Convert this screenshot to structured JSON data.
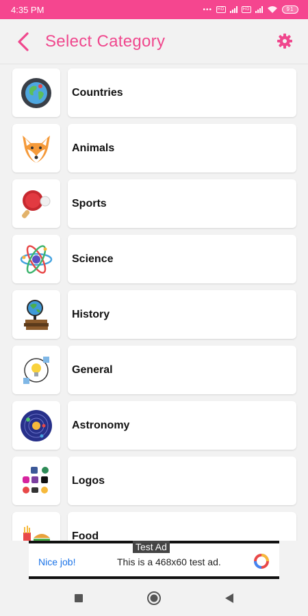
{
  "status_bar": {
    "time": "4:35 PM",
    "indicators": "•••",
    "battery": "91"
  },
  "header": {
    "title": "Select Category"
  },
  "categories": [
    {
      "label": "Countries",
      "icon": "globe-icon"
    },
    {
      "label": "Animals",
      "icon": "fox-icon"
    },
    {
      "label": "Sports",
      "icon": "ping-pong-icon"
    },
    {
      "label": "Science",
      "icon": "atom-icon"
    },
    {
      "label": "History",
      "icon": "globe-books-icon"
    },
    {
      "label": "General",
      "icon": "lightbulb-icon"
    },
    {
      "label": "Astronomy",
      "icon": "solar-system-icon"
    },
    {
      "label": "Logos",
      "icon": "logos-icon"
    },
    {
      "label": "Food",
      "icon": "food-icon"
    }
  ],
  "ad": {
    "tag": "Test Ad",
    "nice": "Nice job!",
    "text": "This is a 468x60 test ad."
  },
  "colors": {
    "accent": "#f0478d",
    "status_bar": "#f5468f",
    "background": "#f2f2f2"
  }
}
